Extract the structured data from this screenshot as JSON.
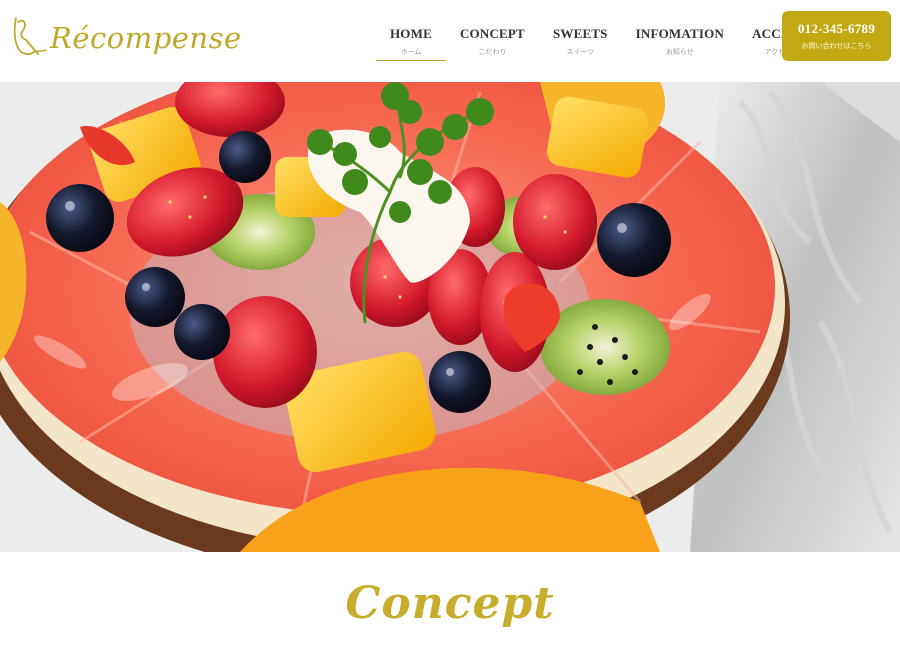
{
  "brand": {
    "name": "Récompense",
    "logo_icon": "script-r-logo-icon",
    "accent_color": "#c2a914"
  },
  "nav": {
    "items": [
      {
        "en": "HOME",
        "jp": "ホーム",
        "active": true
      },
      {
        "en": "CONCEPT",
        "jp": "こだわり",
        "active": false
      },
      {
        "en": "SWEETS",
        "jp": "スイーツ",
        "active": false
      },
      {
        "en": "INFOMATION",
        "jp": "お知らせ",
        "active": false
      },
      {
        "en": "ACCESS",
        "jp": "アクセス",
        "active": false
      }
    ]
  },
  "contact": {
    "phone": "012-345-6789",
    "label": "お問い合わせはこちら"
  },
  "hero": {
    "image": "fruit-tart-photo"
  },
  "section": {
    "title": "Concept"
  }
}
